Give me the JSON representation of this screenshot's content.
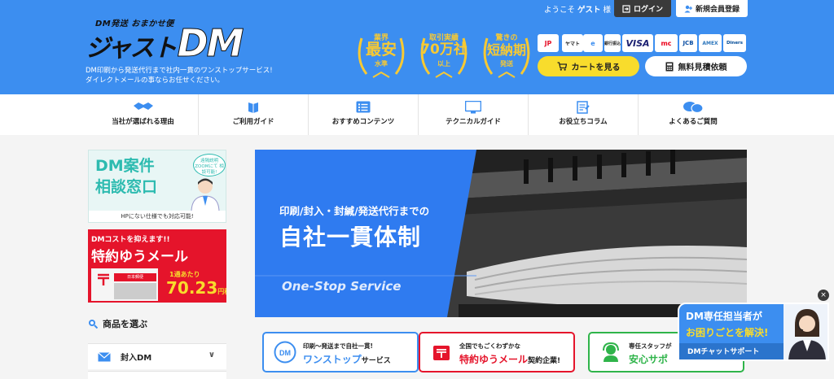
{
  "header": {
    "logo_sub": "DM発送 おまかせ便",
    "logo_kana": "ジャスト",
    "logo_dm": "DM",
    "tagline_1": "DM印刷から発送代行まで社内一貫のワンストップサービス!",
    "tagline_2": "ダイレクトメールの事ならお任せください。",
    "greeting_prefix": "ようこそ",
    "greeting_name": "ゲスト",
    "greeting_suffix": "様",
    "login_label": "ログイン",
    "register_label": "新規会員登録",
    "cart_label": "カートを見る",
    "quote_label": "無料見積依頼",
    "badges": [
      {
        "top": "業界",
        "big": "最安",
        "foot": "水準"
      },
      {
        "top": "取引実績",
        "big": "70万社",
        "foot": "以上"
      },
      {
        "top": "驚きの",
        "big": "短納期",
        "foot": "発送"
      }
    ],
    "payments": [
      "JP",
      "ヤマト",
      "e",
      "銀行振込",
      "VISA",
      "mc",
      "JCB",
      "AMEX",
      "Diners"
    ]
  },
  "nav": [
    {
      "label": "当社が選ばれる理由",
      "icon": "handshake-icon"
    },
    {
      "label": "ご利用ガイド",
      "icon": "guide-icon"
    },
    {
      "label": "おすすめコンテンツ",
      "icon": "list-icon"
    },
    {
      "label": "テクニカルガイド",
      "icon": "monitor-icon"
    },
    {
      "label": "お役立ちコラム",
      "icon": "document-icon"
    },
    {
      "label": "よくあるご質問",
      "icon": "chat-bubbles-icon"
    }
  ],
  "sidebar": {
    "banner1": {
      "line1": "DM案件",
      "line2": "相談窓口",
      "bubble": "遠隔説明 ZOOMにて 相談可能!",
      "foot": "HPにない仕様でも対応可能!"
    },
    "banner2": {
      "top": "DMコストを抑えます!!",
      "main": "特約ゆうメール",
      "unit": "1通あたり",
      "price": "70.23",
      "price_suffix": "円税込〜",
      "sign": "日本郵便"
    },
    "section_title": "商品を選ぶ",
    "categories": [
      {
        "label": "封入DM"
      }
    ]
  },
  "hero": {
    "sub": "印刷/封入・封緘/発送代行までの",
    "main": "自社一貫体制",
    "eng": "One-Stop Service"
  },
  "features": [
    {
      "line1": "印刷〜発送まで自社一貫!",
      "line2": "ワンストップ",
      "line2_small": "サービス",
      "color": "#3c8ef0"
    },
    {
      "line1": "全国でもごくわずかな",
      "line2": "特約ゆうメール",
      "line2_small": "契約企業!",
      "color": "#e5142b"
    },
    {
      "line1": "専任スタッフが",
      "line2": "安心サポ",
      "line2_small": "",
      "color": "#2fb44a"
    }
  ],
  "chat": {
    "line1": "DM専任担当者が",
    "line2": "お困りごとを解決!",
    "foot": "DMチャットサポート",
    "close": "×"
  },
  "colors": {
    "brand_blue": "#3c8ef0",
    "accent_yellow": "#f8dc2c",
    "red": "#e5142b",
    "teal": "#2dbbb0",
    "green": "#2fb44a"
  }
}
